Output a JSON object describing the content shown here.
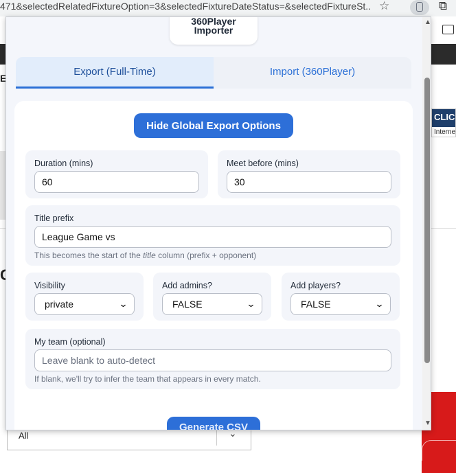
{
  "browser": {
    "url_text": "471&selectedRelatedFixtureOption=3&selectedFixtureDateStatus=&selectedFixtureSt...",
    "bookmark_icon": "star-icon",
    "extension_icon": "extension-icon",
    "puzzle_icon": "puzzle-icon"
  },
  "background": {
    "partial_text_left": "ES",
    "partial_heading": "C",
    "ad_top": "CLICK",
    "ad_bottom": "Internet",
    "filter_select_value": "All"
  },
  "popup": {
    "logo_line1": "360Player",
    "logo_line2": "Importer",
    "tabs": [
      {
        "label": "Export (Full-Time)",
        "active": true
      },
      {
        "label": "Import (360Player)",
        "active": false
      }
    ],
    "toggle_button": "Hide Global Export Options",
    "duration": {
      "label": "Duration (mins)",
      "value": "60"
    },
    "meet_before": {
      "label": "Meet before (mins)",
      "value": "30"
    },
    "title_prefix": {
      "label": "Title prefix",
      "value": "League Game vs",
      "hint_before": "This becomes the start of the ",
      "hint_em": "title",
      "hint_after": " column (prefix + opponent)"
    },
    "visibility": {
      "label": "Visibility",
      "value": "private"
    },
    "add_admins": {
      "label": "Add admins?",
      "value": "FALSE"
    },
    "add_players": {
      "label": "Add players?",
      "value": "FALSE"
    },
    "my_team": {
      "label": "My team (optional)",
      "placeholder": "Leave blank to auto-detect",
      "hint": "If blank, we'll try to infer the team that appears in every match."
    },
    "generate_button": "Generate CSV"
  }
}
